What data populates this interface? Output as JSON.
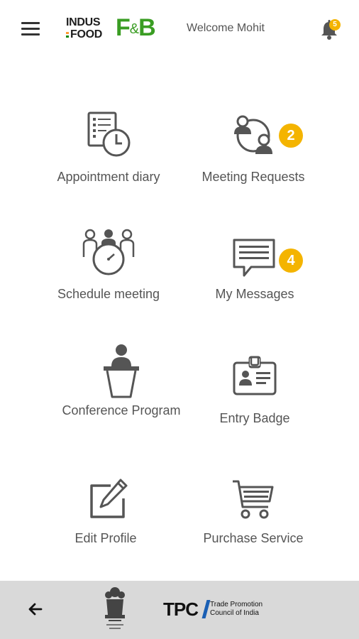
{
  "header": {
    "logo_line1": "INDUS",
    "logo_line2": "FOOD",
    "logo_fb": "F",
    "logo_amp": "&",
    "logo_b": "B",
    "welcome": "Welcome Mohit",
    "notification_count": "5"
  },
  "tiles": [
    {
      "label": "Appointment diary"
    },
    {
      "label": "Meeting Requests",
      "badge": "2"
    },
    {
      "label": "Schedule meeting"
    },
    {
      "label": "My Messages",
      "badge": "4"
    },
    {
      "label": "Conference Program"
    },
    {
      "label": "Entry Badge"
    },
    {
      "label": "Edit Profile"
    },
    {
      "label": "Purchase Service"
    }
  ],
  "footer": {
    "tpci_logo": "TPC",
    "tpci_line1": "Trade Promotion",
    "tpci_line2": "Council of India"
  },
  "colors": {
    "accent": "#f4b400",
    "brand_green": "#3a9d23",
    "icon": "#555555",
    "footer_bg": "#d9d9d9"
  }
}
